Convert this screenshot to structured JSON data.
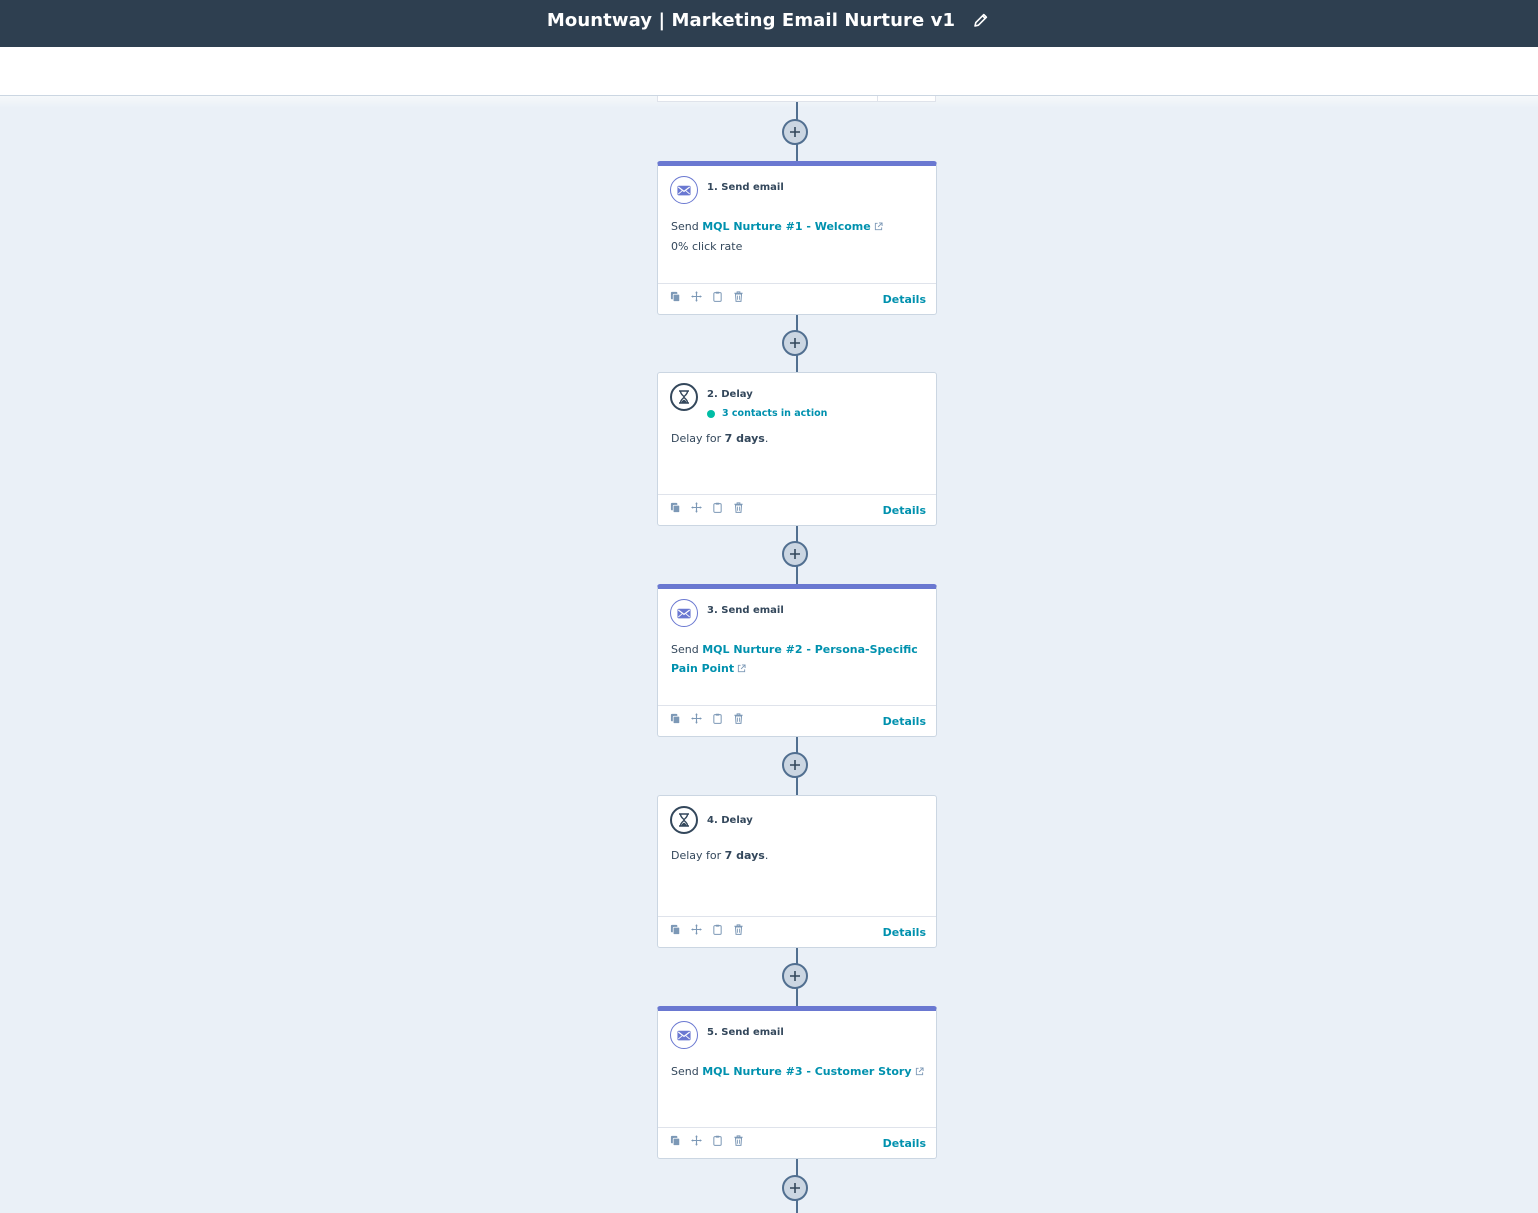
{
  "header": {
    "title": "Mountway | Marketing Email Nurture v1",
    "edit_icon": "pencil-icon"
  },
  "colors": {
    "topbar": "#2e3f50",
    "canvas": "#eaf0f7",
    "accent_email": "#6a78d1",
    "link": "#0091ae",
    "status_dot": "#00bda5"
  },
  "steps": [
    {
      "label": "1. Send email",
      "icon": "mail-icon",
      "send_prefix": "Send",
      "email_name": "MQL Nurture #1 - Welcome",
      "metric": "0% click rate",
      "details": "Details"
    },
    {
      "label": "2. Delay",
      "icon": "hourglass-icon",
      "status": "3 contacts in action",
      "delay_prefix": "Delay for",
      "delay_value": "7 days",
      "delay_suffix": ".",
      "details": "Details"
    },
    {
      "label": "3. Send email",
      "icon": "mail-icon",
      "send_prefix": "Send",
      "email_name": "MQL Nurture #2 - Persona-Specific Pain Point",
      "details": "Details"
    },
    {
      "label": "4. Delay",
      "icon": "hourglass-icon",
      "delay_prefix": "Delay for",
      "delay_value": "7 days",
      "delay_suffix": ".",
      "details": "Details"
    },
    {
      "label": "5. Send email",
      "icon": "mail-icon",
      "send_prefix": "Send",
      "email_name": "MQL Nurture #3 - Customer Story",
      "details": "Details"
    }
  ],
  "card_tools": [
    "copy-icon",
    "move-icon",
    "clipboard-icon",
    "trash-icon"
  ]
}
